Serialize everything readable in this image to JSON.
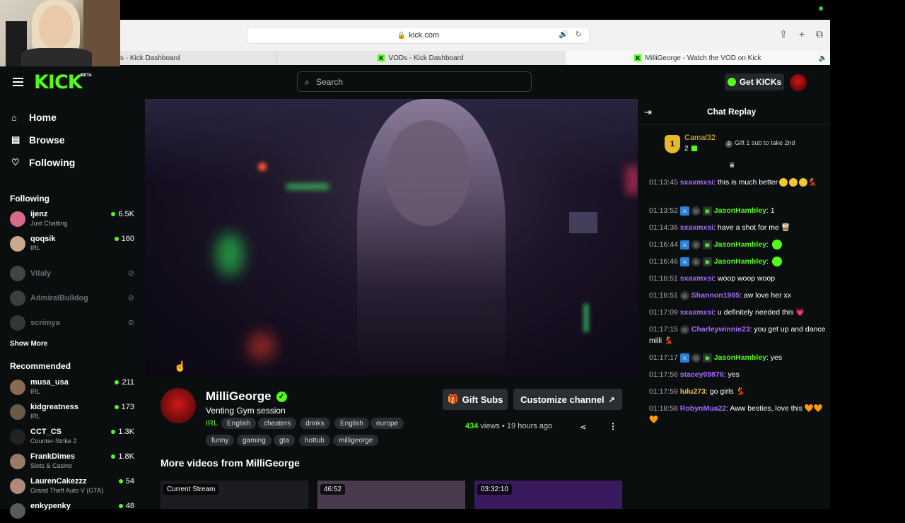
{
  "browser": {
    "url": "kick.com",
    "tabs": [
      {
        "label": "s - Kick Dashboard"
      },
      {
        "label": "VODs - Kick Dashboard"
      },
      {
        "label": "MilliGeorge - Watch the VOD on Kick"
      }
    ]
  },
  "header": {
    "logo": "KICK",
    "beta": "BETA",
    "search_placeholder": "Search",
    "get_kicks": "Get KICKs"
  },
  "sidebar": {
    "nav": [
      {
        "label": "Home"
      },
      {
        "label": "Browse"
      },
      {
        "label": "Following"
      }
    ],
    "following_title": "Following",
    "following": [
      {
        "name": "ijenz",
        "category": "Just Chatting",
        "viewers": "6.5K",
        "avatar_color": "#d86a8a"
      },
      {
        "name": "qoqsik",
        "category": "IRL",
        "viewers": "160",
        "avatar_color": "#c9a98a"
      },
      {
        "name": "Vitaly",
        "avatar_color": "#888888"
      },
      {
        "name": "AdmiralBulldog",
        "avatar_color": "#7a7a7a"
      },
      {
        "name": "scrimya",
        "avatar_color": "#6a6a6a"
      }
    ],
    "show_more": "Show More",
    "recommended_title": "Recommended",
    "recommended": [
      {
        "name": "musa_usa",
        "category": "IRL",
        "viewers": "211",
        "avatar_color": "#8a6a50"
      },
      {
        "name": "kidgreatness",
        "category": "IRL",
        "viewers": "173",
        "avatar_color": "#6a5a4a"
      },
      {
        "name": "CCT_CS",
        "category": "Counter-Strike 2",
        "viewers": "1.3K",
        "avatar_color": "#222222"
      },
      {
        "name": "FrankDimes",
        "category": "Slots & Casino",
        "viewers": "1.8K",
        "avatar_color": "#9a7a6a"
      },
      {
        "name": "LaurenCakezzz",
        "category": "Grand Theft Auto V (GTA)",
        "viewers": "54",
        "avatar_color": "#b08a7a"
      },
      {
        "name": "enkypenky",
        "viewers": "48",
        "avatar_color": "#5a5a5a"
      }
    ]
  },
  "video_info": {
    "channel": "MilliGeorge",
    "title": "Venting Gym session",
    "category": "IRL",
    "tags_row1": [
      "English",
      "cheaters",
      "drinks",
      "English",
      "europe"
    ],
    "tags_row2": [
      "funny",
      "gaming",
      "gta",
      "hottub",
      "milligeorge"
    ],
    "gift_subs": "Gift Subs",
    "customize": "Customize channel",
    "views_count": "434",
    "views_label": "views",
    "time_ago": "19 hours ago",
    "more_videos_title": "More videos from MilliGeorge",
    "thumbnails": [
      {
        "label": "Current Stream",
        "color": "#1a1c20"
      },
      {
        "label": "46:52",
        "color": "#4a3a4e"
      },
      {
        "label": "03:32:10",
        "color": "#3a1a5e"
      }
    ]
  },
  "chat": {
    "title": "Chat Replay",
    "top_gifter": {
      "rank": "1",
      "name": "Camal32",
      "count": "2",
      "cta": "Gift 1 sub to take 2nd"
    },
    "messages": [
      {
        "time": "01:13:45",
        "user": "sxaxmxsi",
        "color": "#a66bff",
        "text": ": this is much better",
        "emotes": 3,
        "tail": "💃"
      },
      {
        "time": "01:13:52",
        "user": "JasonHambley",
        "color": "#53fc18",
        "text": ": 1",
        "badges": true
      },
      {
        "time": "01:14:36",
        "user": "sxaxmxsi",
        "color": "#a66bff",
        "text": ": have a shot for me 🥃"
      },
      {
        "time": "01:16:44",
        "user": "JasonHambley",
        "color": "#53fc18",
        "text": ":",
        "badges": true,
        "green": true
      },
      {
        "time": "01:16:46",
        "user": "JasonHambley",
        "color": "#53fc18",
        "text": ":",
        "badges": true,
        "green": true
      },
      {
        "time": "01:16:51",
        "user": "sxaxmxsi",
        "color": "#a66bff",
        "text": ": woop woop woop"
      },
      {
        "time": "01:16:51",
        "user": "Shannon1995",
        "color": "#a66bff",
        "text": ": aw love her xx",
        "og": true
      },
      {
        "time": "01:17:09",
        "user": "sxaxmxsi",
        "color": "#a66bff",
        "text": ": u definitely needed this 💗"
      },
      {
        "time": "01:17:15",
        "user": "Charleywinnie23",
        "color": "#a66bff",
        "text": ": you get up and dance milli 💃",
        "og": true
      },
      {
        "time": "01:17:17",
        "user": "JasonHambley",
        "color": "#53fc18",
        "text": ": yes",
        "badges": true
      },
      {
        "time": "01:17:56",
        "user": "stacey09876",
        "color": "#a66bff",
        "text": ": yes"
      },
      {
        "time": "01:17:59",
        "user": "lulu273",
        "color": "#f0c24a",
        "text": ": go girls 💃"
      },
      {
        "time": "01:18:58",
        "user": "RobynMua22",
        "color": "#a66bff",
        "text": ": Aww besties, love this 🧡🧡🧡"
      }
    ]
  }
}
